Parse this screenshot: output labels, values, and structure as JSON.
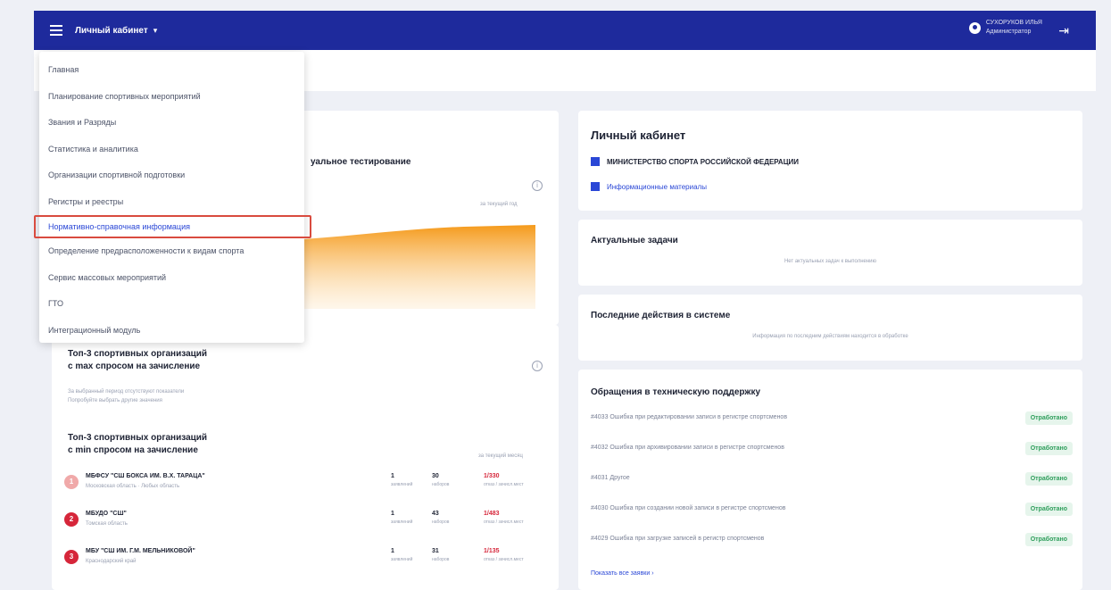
{
  "topbar": {
    "title": "Личный кабинет",
    "user_name": "СУХОРУКОВ ИЛЬЯ",
    "user_role": "Администратор"
  },
  "menu": {
    "items": [
      "Главная",
      "Планирование спортивных мероприятий",
      "Звания и Разряды",
      "Статистика и аналитика",
      "Организации спортивной подготовки",
      "Регистры и реестры",
      "Нормативно-справочная информация",
      "Определение предрасположенности к видам спорта",
      "Сервис массовых мероприятий",
      "ГТО",
      "Интеграционный модуль"
    ]
  },
  "left": {
    "testing_title": "уальное тестирование",
    "period_label": "за текущий год",
    "axis_labels": [
      "",
      "",
      ""
    ],
    "top3_max_title_1": "Топ-3 спортивных организаций",
    "top3_max_title_2": "с max спросом на зачисление",
    "top3_max_empty_1": "За выбранный период отсутствуют показатели",
    "top3_max_empty_2": "Попробуйте выбрать другие значения",
    "top3_min_title_1": "Топ-3 спортивных организаций",
    "top3_min_title_2": "с min спросом на зачисление",
    "top3_min_period": "за текущий месяц",
    "orgs": [
      {
        "rank": "1",
        "name": "МБФСУ \"СШ БОКСА ИМ. В.Х. ТАРАЦА\"",
        "region": "Московская область · Любых область",
        "a": "1",
        "a_lbl": "заявлений",
        "b": "30",
        "b_lbl": "наборов",
        "c": "1/330",
        "c_lbl": "отказ / зачисл.мест",
        "color": "#f0a9a9"
      },
      {
        "rank": "2",
        "name": "МБУДО \"СШ\"",
        "region": "Томская область",
        "a": "1",
        "a_lbl": "заявлений",
        "b": "43",
        "b_lbl": "наборов",
        "c": "1/483",
        "c_lbl": "отказ / зачисл.мест",
        "color": "#d6263a"
      },
      {
        "rank": "3",
        "name": "МБУ \"СШ ИМ. Г.М. МЕЛЬНИКОВОЙ\"",
        "region": "Краснодарский край",
        "a": "1",
        "a_lbl": "заявлений",
        "b": "31",
        "b_lbl": "наборов",
        "c": "1/135",
        "c_lbl": "отказ / зачисл.мест",
        "color": "#d6263a"
      }
    ]
  },
  "right": {
    "cabinet_title": "Личный кабинет",
    "ministry": "МИНИСТЕРСТВО СПОРТА РОССИЙСКОЙ ФЕДЕРАЦИИ",
    "info_link": "Информационные материалы",
    "tasks_title": "Актуальные задачи",
    "tasks_empty": "Нет актуальных задач к выполнению",
    "actions_title": "Последние действия в системе",
    "actions_empty": "Информация по последним действиям находится в обработке",
    "support_title": "Обращения в техническую поддержку",
    "requests": [
      {
        "text": "#4033 Ошибка при редактировании записи в регистре спортсменов",
        "status": "Отработано"
      },
      {
        "text": "#4032 Ошибка при архивировании записи в регистре спортсменов",
        "status": "Отработано"
      },
      {
        "text": "#4031 Другое",
        "status": "Отработано"
      },
      {
        "text": "#4030 Ошибка при создании новой записи в регистре спортсменов",
        "status": "Отработано"
      },
      {
        "text": "#4029 Ошибка при загрузке записей в регистр спортсменов",
        "status": "Отработано"
      }
    ],
    "show_all": "Показать все заявки ›"
  },
  "colors": {
    "topbar": "#1e2a9c",
    "accent": "#2a47d6",
    "highlight_border": "#d94b3f",
    "chart_fill": "#f59a1b"
  }
}
